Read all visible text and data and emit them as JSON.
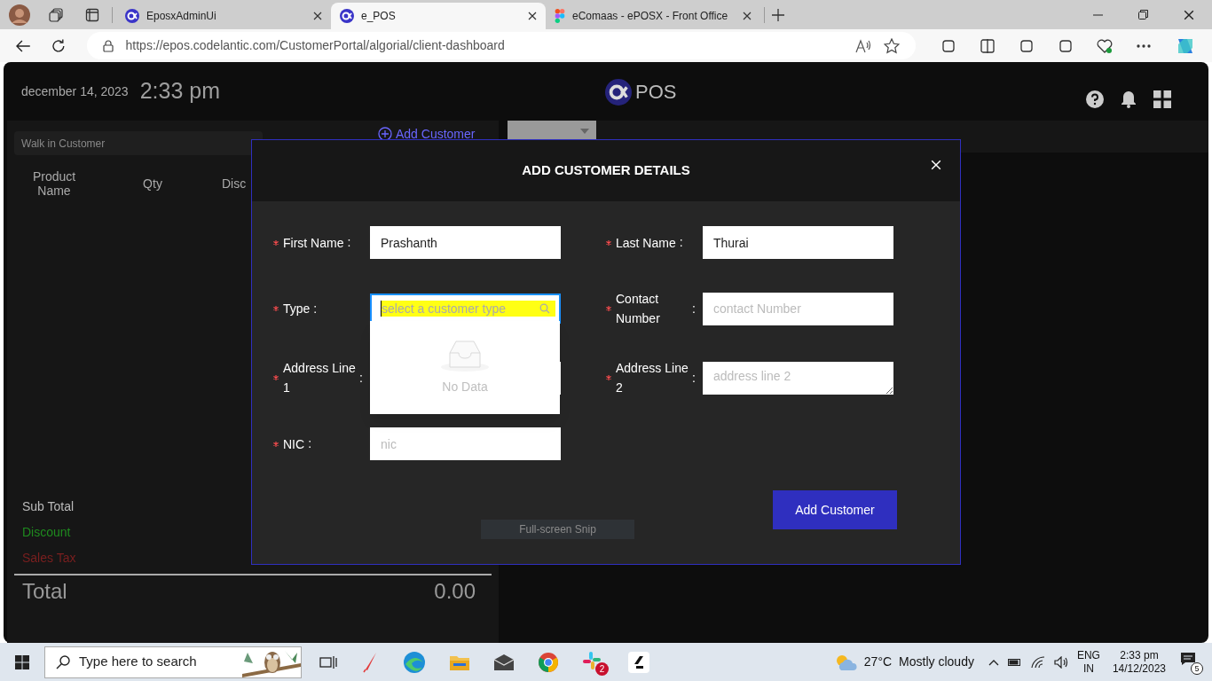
{
  "browser": {
    "tabs": [
      {
        "title": "EposxAdminUi",
        "kind": "app",
        "selected": false
      },
      {
        "title": "e_POS",
        "kind": "app",
        "selected": true
      },
      {
        "title": "eComaas - ePOSX - Front Office",
        "kind": "figma",
        "selected": false
      }
    ],
    "url": "https://epos.codelantic.com/CustomerPortal/algorial/client-dashboard"
  },
  "app": {
    "date": "december 14, 2023",
    "time": "2:33 pm",
    "logo_text": "POS",
    "customer_field": {
      "placeholder": "Walk in Customer"
    },
    "add_customer_link": "Add Customer",
    "columns": [
      "Product Name",
      "Qty",
      "Disc"
    ],
    "summary": [
      {
        "label": "Sub Total",
        "kind": "plain"
      },
      {
        "label": "Discount",
        "kind": "discount"
      },
      {
        "label": "Sales Tax",
        "kind": "tax"
      }
    ],
    "total": {
      "label": "Total",
      "value": "0.00"
    }
  },
  "modal": {
    "title": "ADD CUSTOMER DETAILS",
    "fields": [
      {
        "label": "First Name",
        "colon": ":",
        "required": true,
        "kind": "input",
        "value": "Prashanth"
      },
      {
        "label": "Last Name",
        "colon": ":",
        "required": true,
        "kind": "input",
        "value": "Thurai"
      },
      {
        "label": "Type",
        "colon": ":",
        "required": true,
        "kind": "select",
        "placeholder": "select a customer type",
        "open": true,
        "empty_text": "No Data"
      },
      {
        "label": "Contact Number",
        "colon": ":",
        "required": true,
        "kind": "input",
        "placeholder": "contact Number"
      },
      {
        "label": "Address Line 1",
        "colon": ":",
        "required": true,
        "kind": "input"
      },
      {
        "label": "Address Line 2",
        "colon": ":",
        "required": true,
        "kind": "textarea",
        "placeholder": "address line 2"
      },
      {
        "label": "NIC",
        "colon": ":",
        "required": true,
        "kind": "input",
        "placeholder": "nic"
      }
    ],
    "submit": "Add Customer"
  },
  "tooltip": "Full-screen Snip",
  "taskbar": {
    "search_placeholder": "Type here to search",
    "slack_badge": "2",
    "weather": {
      "temp": "27°C",
      "text": "Mostly cloudy"
    },
    "language": "ENG",
    "region": "IN",
    "time": "2:33 pm",
    "date": "14/12/2023",
    "notifications": "5"
  }
}
